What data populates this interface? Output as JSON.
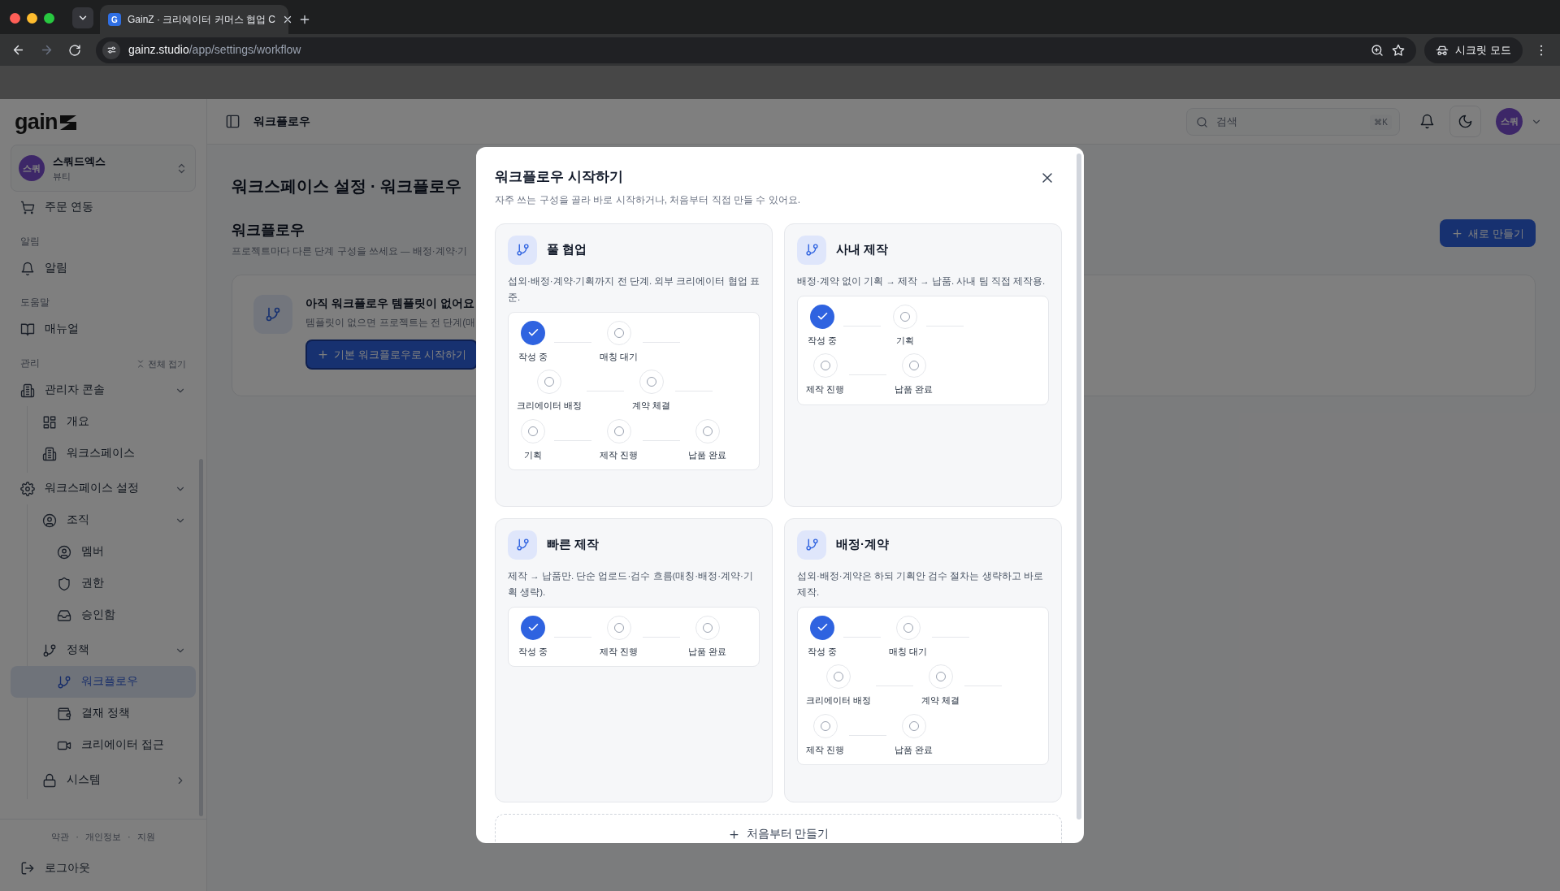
{
  "browser": {
    "tab": {
      "favicon": "G",
      "title": "GainZ · 크리에이터 커머스 협업 C"
    },
    "url": {
      "host": "gainz.studio",
      "path": "/app/settings/workflow"
    },
    "profile": "시크릿 모드"
  },
  "sidebar": {
    "logo": "gain",
    "workspace": {
      "avatar": "스쿼",
      "name": "스쿼드엑스",
      "category": "뷰티"
    },
    "groups": [
      {
        "items": [
          {
            "label": "주문 연동",
            "selected": false
          }
        ]
      },
      {
        "heading": "알림",
        "items": [
          {
            "label": "알림",
            "selected": false
          }
        ]
      },
      {
        "heading": "도움말",
        "items": [
          {
            "label": "매뉴얼",
            "selected": false
          }
        ]
      },
      {
        "heading": "관리",
        "action": "전체 접기",
        "items": [
          {
            "label": "관리자 콘솔",
            "selected": false,
            "expanded": true,
            "children": [
              {
                "label": "개요",
                "selected": false
              },
              {
                "label": "워크스페이스",
                "selected": false
              }
            ]
          },
          {
            "label": "워크스페이스 설정",
            "selected": false,
            "expanded": true,
            "children": [
              {
                "label": "조직",
                "selected": false,
                "expanded": true,
                "children": [
                  {
                    "label": "멤버",
                    "selected": false
                  },
                  {
                    "label": "권한",
                    "selected": false
                  },
                  {
                    "label": "승인함",
                    "selected": false
                  }
                ]
              },
              {
                "label": "정책",
                "selected": false,
                "expanded": true,
                "children": [
                  {
                    "label": "워크플로우",
                    "selected": true
                  },
                  {
                    "label": "결재 정책",
                    "selected": false
                  },
                  {
                    "label": "크리에이터 접근",
                    "selected": false
                  }
                ]
              },
              {
                "label": "시스템",
                "selected": false,
                "expanded": false
              }
            ]
          }
        ]
      }
    ],
    "footer_links": [
      "약관",
      "개인정보",
      "지원"
    ],
    "footer_separator": "·",
    "logout": "로그아웃"
  },
  "header": {
    "title": "워크플로우",
    "search": {
      "placeholder": "검색",
      "shortcut": "⌘K"
    },
    "avatar": "스쿼"
  },
  "page": {
    "title": "워크스페이스 설정 · 워크플로우",
    "section_title": "워크플로우",
    "section_description": "프로젝트마다 다른 단계 구성을 쓰세요 — 배정·계약·기",
    "new_button": "새로 만들기",
    "empty_state": {
      "title": "아직 워크플로우 템플릿이 없어요",
      "description": "템플릿이 없으면 프로젝트는 전 단계(매",
      "button": "기본 워크플로우로 시작하기"
    }
  },
  "dialog": {
    "title": "워크플로우 시작하기",
    "subtitle": "자주 쓰는 구성을 골라 바로 시작하거나, 처음부터 직접 만들 수 있어요.",
    "templates": [
      {
        "name": "풀 협업",
        "description": "섭외·배정·계약·기획까지 전 단계. 외부 크리에이터 협업 표준.",
        "steps": [
          {
            "label": "작성 중",
            "checked": true
          },
          {
            "label": "매칭 대기",
            "checked": false
          },
          {
            "label": "크리에이터 배정",
            "checked": false
          },
          {
            "label": "계약 체결",
            "checked": false
          },
          {
            "label": "기획",
            "checked": false
          },
          {
            "label": "제작 진행",
            "checked": false
          },
          {
            "label": "납품 완료",
            "checked": false
          }
        ]
      },
      {
        "name": "사내 제작",
        "description": "배정·계약 없이 기획 → 제작 → 납품. 사내 팀 직접 제작용.",
        "steps": [
          {
            "label": "작성 중",
            "checked": true
          },
          {
            "label": "기획",
            "checked": false
          },
          {
            "label": "제작 진행",
            "checked": false
          },
          {
            "label": "납품 완료",
            "checked": false
          }
        ]
      },
      {
        "name": "빠른 제작",
        "description": "제작 → 납품만. 단순 업로드·검수 흐름(매칭·배정·계약·기획 생략).",
        "steps": [
          {
            "label": "작성 중",
            "checked": true
          },
          {
            "label": "제작 진행",
            "checked": false
          },
          {
            "label": "납품 완료",
            "checked": false
          }
        ]
      },
      {
        "name": "배정·계약",
        "description": "섭외·배정·계약은 하되 기획안 검수 절차는 생략하고 바로 제작.",
        "steps": [
          {
            "label": "작성 중",
            "checked": true
          },
          {
            "label": "매칭 대기",
            "checked": false
          },
          {
            "label": "크리에이터 배정",
            "checked": false
          },
          {
            "label": "계약 체결",
            "checked": false
          },
          {
            "label": "제작 진행",
            "checked": false
          },
          {
            "label": "납품 완료",
            "checked": false
          }
        ]
      }
    ],
    "blank_button": "처음부터 만들기"
  }
}
